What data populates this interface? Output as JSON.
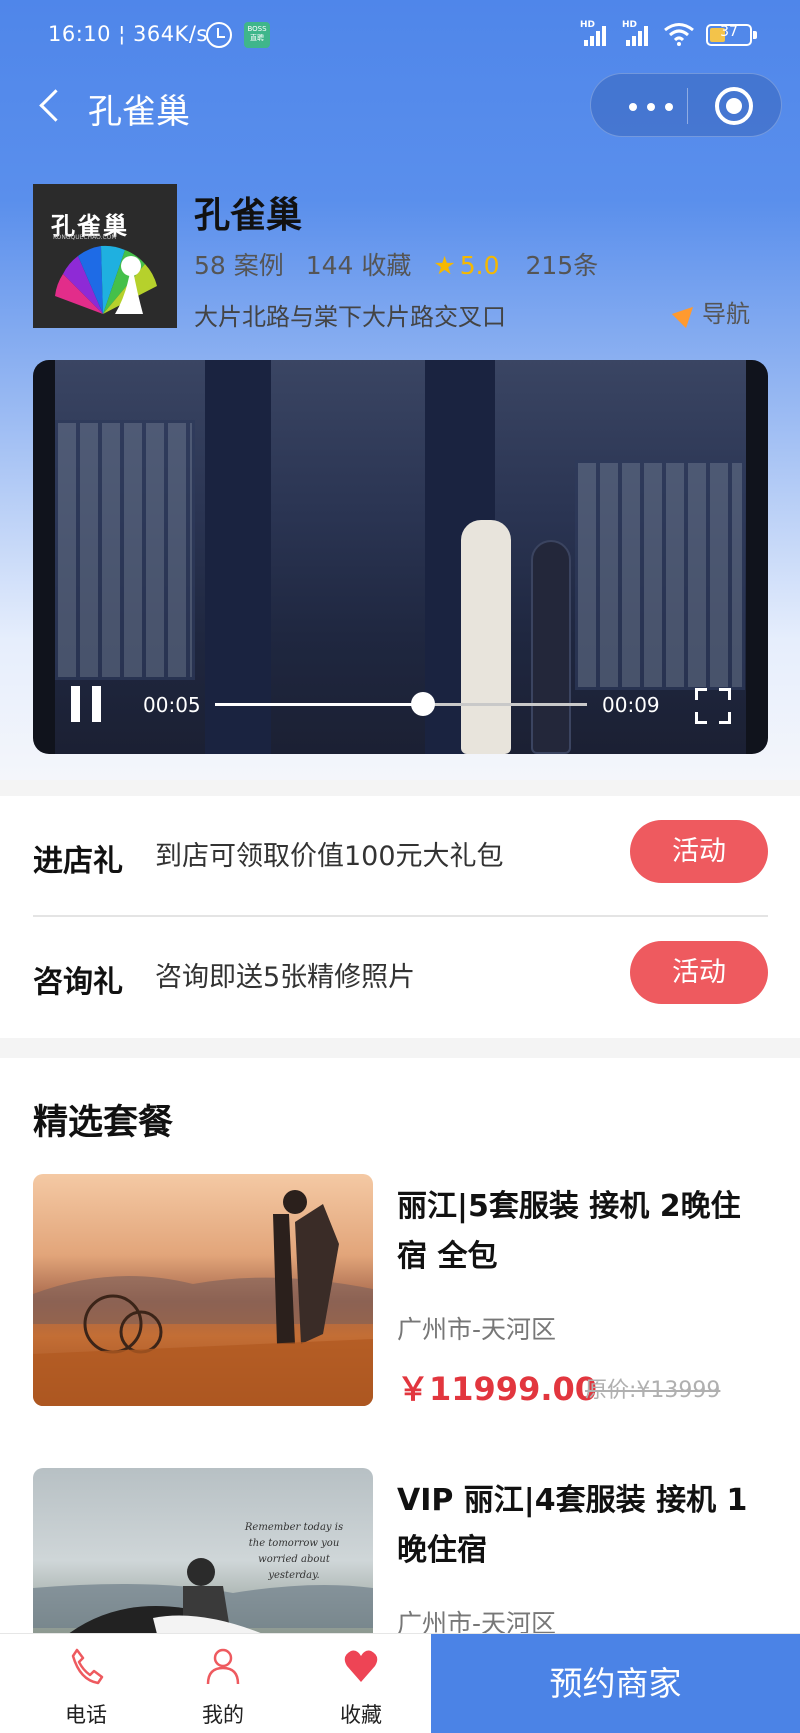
{
  "status_bar": {
    "time": "16:10",
    "speed": "364K/s",
    "battery": "37",
    "boss_badge": "BOSS\n直聘",
    "hd": "HD"
  },
  "nav": {
    "title": "孔雀巢"
  },
  "shop": {
    "name": "孔雀巢",
    "logo_text": "孔雀巢",
    "logo_sub": "KONGQUECHAO.COM",
    "cases": "58 案例",
    "favorites": "144 收藏",
    "rating": "5.0",
    "reviews": "215条",
    "address": "大片北路与棠下大片路交叉口",
    "navigate_label": "导航"
  },
  "video": {
    "current_time": "00:05",
    "total_time": "00:09",
    "progress": 0.56
  },
  "promotions": [
    {
      "label": "进店礼",
      "desc": "到店可领取价值100元大礼包",
      "button": "活动"
    },
    {
      "label": "咨询礼",
      "desc": "咨询即送5张精修照片",
      "button": "活动"
    }
  ],
  "packages": {
    "title": "精选套餐",
    "items": [
      {
        "name": "丽江|5套服装 接机 2晚住宿 全包",
        "location": "广州市-天河区",
        "price": "￥11999.00",
        "original": "原价:¥13999"
      },
      {
        "name": "VIP 丽江|4套服装 接机 1晚住宿",
        "location": "广州市-天河区",
        "price": "",
        "original": ""
      }
    ],
    "thumb2_caption": "Remember today is the tomorrow you worried about yesterday."
  },
  "tabbar": {
    "phone": "电话",
    "mine": "我的",
    "favorite": "收藏",
    "book": "预约商家"
  },
  "colors": {
    "brand_blue": "#4b83e6",
    "accent_red": "#ee5a5f",
    "price_red": "#e2363e",
    "star": "#f5b800"
  }
}
